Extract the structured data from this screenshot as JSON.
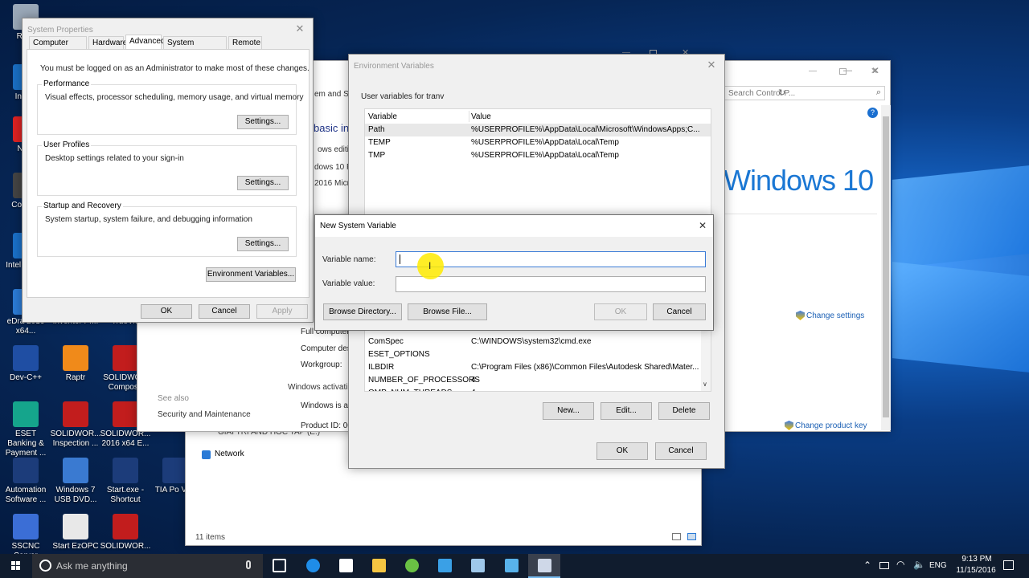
{
  "desktop": {
    "icons": [
      {
        "label": "Recy",
        "color": "#9aa8b8"
      },
      {
        "label": "Int Dri",
        "color": "#1a6fc4"
      },
      {
        "label": "Nitro",
        "color": "#d22"
      },
      {
        "label": "Co Strik",
        "color": "#444"
      },
      {
        "label": "Intel Graph",
        "color": "#1a70c8"
      },
      {
        "label": "eDra 2016 x64...",
        "color": "#2b7bd6"
      },
      {
        "label": "Dev-C++",
        "color": "#1f4ea3"
      },
      {
        "label": "ESET Banking & Payment ...",
        "color": "#15a58c"
      },
      {
        "label": "Automation Software ...",
        "color": "#1c3c7a"
      },
      {
        "label": "SSCNC Server",
        "color": "#3b6ed6"
      },
      {
        "label": "Inventor Pr...",
        "color": "#c87a1a"
      },
      {
        "label": "TrueVie",
        "color": "#7a7a9a"
      },
      {
        "label": "Raptr",
        "color": "#f08a1a"
      },
      {
        "label": "SOLIDWO... Compose",
        "color": "#c21d1d"
      },
      {
        "label": "SOLIDWOR... Inspection ...",
        "color": "#c21d1d"
      },
      {
        "label": "SOLIDWOR... 2016 x64 E...",
        "color": "#c21d1d"
      },
      {
        "label": "Windows 7 USB DVD...",
        "color": "#3a7ad1"
      },
      {
        "label": "Start.exe - Shortcut",
        "color": "#1c3c7a"
      },
      {
        "label": "TIA Po V13",
        "color": "#1c3c7a"
      },
      {
        "label": "Start EzOPC",
        "color": "#e8e8e8"
      },
      {
        "label": "SOLIDWOR...",
        "color": "#c21d1d"
      }
    ],
    "win10_logo_text": "Windows 10"
  },
  "system_properties": {
    "title": "System Properties",
    "tabs": [
      "Computer Name",
      "Hardware",
      "Advanced",
      "System Protection",
      "Remote"
    ],
    "admin_note": "You must be logged on as an Administrator to make most of these changes.",
    "performance": {
      "label": "Performance",
      "desc": "Visual effects, processor scheduling, memory usage, and virtual memory",
      "button": "Settings..."
    },
    "user_profiles": {
      "label": "User Profiles",
      "desc": "Desktop settings related to your sign-in",
      "button": "Settings..."
    },
    "startup": {
      "label": "Startup and Recovery",
      "desc": "System startup, system failure, and debugging information",
      "button": "Settings..."
    },
    "env_button": "Environment Variables...",
    "ok": "OK",
    "cancel": "Cancel",
    "apply": "Apply"
  },
  "system_window": {
    "search_placeholder": "Search Control P...",
    "frag_settings": "em and Se",
    "frag_basic": "basic inf",
    "frag_edition": "ows edition",
    "frag_w10": "dows 10 P",
    "frag_2016": "2016 Micro",
    "full_computer": "Full computer",
    "computer_desc": "Computer des",
    "workgroup": "Workgroup:",
    "windows_activation": "Windows activati",
    "windows_is_ac": "Windows is ac",
    "product_id": "Product ID: 00",
    "see_also": "See also",
    "security": "Security and Maintenance",
    "change_settings": "Change settings",
    "change_product_key": "Change product key"
  },
  "explorer": {
    "drive": "GIAI TRI AND HOC TAP (E:)",
    "network": "Network",
    "status": "11 items"
  },
  "env_vars": {
    "title": "Environment Variables",
    "user_label": "User variables for tranv",
    "columns": [
      "Variable",
      "Value"
    ],
    "user_vars": [
      {
        "name": "Path",
        "value": "%USERPROFILE%\\AppData\\Local\\Microsoft\\WindowsApps;C..."
      },
      {
        "name": "TEMP",
        "value": "%USERPROFILE%\\AppData\\Local\\Temp"
      },
      {
        "name": "TMP",
        "value": "%USERPROFILE%\\AppData\\Local\\Temp"
      }
    ],
    "sys_vars": [
      {
        "name": "ComSpec",
        "value": "C:\\WINDOWS\\system32\\cmd.exe"
      },
      {
        "name": "ESET_OPTIONS",
        "value": ""
      },
      {
        "name": "ILBDIR",
        "value": "C:\\Program Files (x86)\\Common Files\\Autodesk Shared\\Mater..."
      },
      {
        "name": "NUMBER_OF_PROCESSORS",
        "value": "4"
      },
      {
        "name": "OMP_NUM_THREADS",
        "value": "4"
      }
    ],
    "new": "New...",
    "edit": "Edit...",
    "delete": "Delete",
    "ok": "OK",
    "cancel": "Cancel"
  },
  "new_var": {
    "title": "New System Variable",
    "name_label": "Variable name:",
    "value_label": "Variable value:",
    "name_value": "",
    "value_value": "",
    "browse_dir": "Browse Directory...",
    "browse_file": "Browse File...",
    "ok": "OK",
    "cancel": "Cancel"
  },
  "taskbar": {
    "search_placeholder": "Ask me anything",
    "lang": "ENG",
    "time": "9:13 PM",
    "date": "11/15/2016"
  }
}
